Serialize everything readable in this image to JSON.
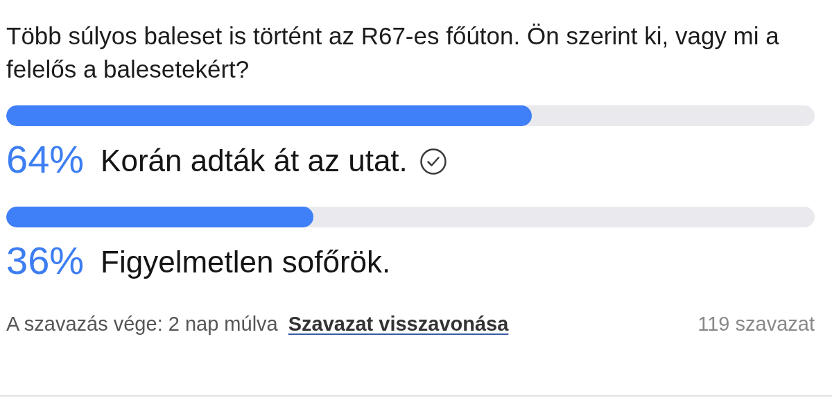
{
  "question": "Több súlyos baleset is történt az R67-es főúton. Ön szerint ki, vagy mi a felelős a balesetekért?",
  "options": [
    {
      "percent": "64%",
      "label": "Korán adták át az utat.",
      "level": 0.65,
      "selected": true
    },
    {
      "percent": "36%",
      "label": "Figyelmetlen sofőrök.",
      "level": 0.38,
      "selected": false
    }
  ],
  "footer": {
    "deadline": "A szavazás vége: 2 nap múlva",
    "retract_link": "Szavazat visszavonása",
    "vote_count": "119 szavazat"
  }
}
